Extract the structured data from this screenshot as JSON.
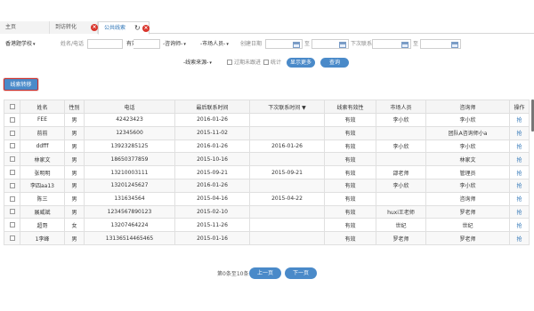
{
  "tabs": [
    {
      "label": "主页"
    },
    {
      "label": "到访转化"
    },
    {
      "label": "公共线索"
    }
  ],
  "filters": {
    "school": "香港题学校",
    "name_phone_label": "姓名/电话",
    "validity": "有效",
    "consultant": "-咨询师-",
    "market_person": "-市场人员-",
    "create_date_label": "创建日期",
    "to_label": "至",
    "next_contact_label": "下次联系",
    "to_label_2": "至",
    "source": "-线索来源-",
    "overdue_label": "过期未跟进",
    "stats_label": "统计",
    "more_button": "显示更多",
    "query_button": "查询"
  },
  "clue_transfer_button": "线索转移",
  "table": {
    "headers": [
      "姓名",
      "性别",
      "电话",
      "最后联系时间",
      "下次联系时间",
      "线索有效性",
      "市场人员",
      "咨询师",
      "操作"
    ],
    "sort_indicator": "▼",
    "rows": [
      {
        "name": "FEE",
        "gender": "男",
        "phone": "42423423",
        "last": "2016-01-26",
        "next": "",
        "validity": "有效",
        "market": "李小欣",
        "consultant": "李小欣",
        "op": "抢"
      },
      {
        "name": "前前",
        "gender": "男",
        "phone": "12345600",
        "last": "2015-11-02",
        "next": "",
        "validity": "有效",
        "market": "",
        "consultant": "团队A咨询师小a",
        "op": "抢"
      },
      {
        "name": "ddfff",
        "gender": "男",
        "phone": "13923285125",
        "last": "2016-01-26",
        "next": "2016-01-26",
        "validity": "有效",
        "market": "李小欣",
        "consultant": "李小欣",
        "op": "抢"
      },
      {
        "name": "林家文",
        "gender": "男",
        "phone": "18650377859",
        "last": "2015-10-16",
        "next": "",
        "validity": "有效",
        "market": "",
        "consultant": "林家文",
        "op": "抢"
      },
      {
        "name": "张明明",
        "gender": "男",
        "phone": "13210003111",
        "last": "2015-09-21",
        "next": "2015-09-21",
        "validity": "有效",
        "market": "邵老师",
        "consultant": "管理员",
        "op": "抢"
      },
      {
        "name": "李四aa13",
        "gender": "男",
        "phone": "13201245627",
        "last": "2016-01-26",
        "next": "",
        "validity": "有效",
        "market": "李小欣",
        "consultant": "李小欣",
        "op": "抢"
      },
      {
        "name": "陈三",
        "gender": "男",
        "phone": "131634564",
        "last": "2015-04-16",
        "next": "2015-04-22",
        "validity": "有效",
        "market": "",
        "consultant": "咨询师",
        "op": "抢"
      },
      {
        "name": "展威斌",
        "gender": "男",
        "phone": "1234567890123",
        "last": "2015-02-10",
        "next": "",
        "validity": "有效",
        "market": "huxi王老师",
        "consultant": "罗老师",
        "op": "抢"
      },
      {
        "name": "超哥",
        "gender": "女",
        "phone": "13207464224",
        "last": "2015-11-26",
        "next": "",
        "validity": "有效",
        "market": "世纪",
        "consultant": "世纪",
        "op": "抢"
      },
      {
        "name": "1李峰",
        "gender": "男",
        "phone": "13136514465465",
        "last": "2015-01-16",
        "next": "",
        "validity": "有效",
        "market": "罗老师",
        "consultant": "罗老师",
        "op": "抢"
      }
    ]
  },
  "pager": {
    "info": "第0条至10条",
    "prev": "上一页",
    "next": "下一页"
  }
}
